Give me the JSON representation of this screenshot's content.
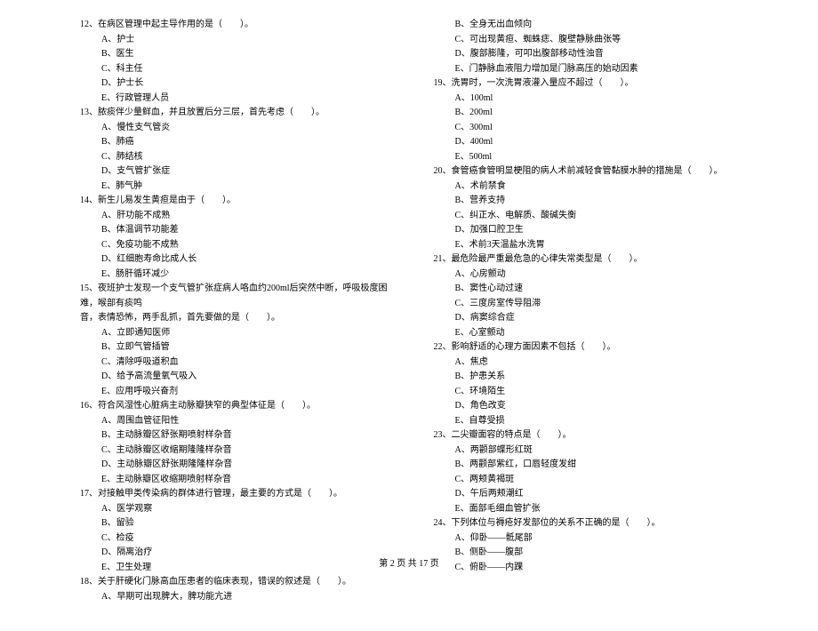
{
  "left_column": {
    "q12": {
      "stem": "12、在病区管理中起主导作用的是（　　）。",
      "options": [
        "A、护士",
        "B、医生",
        "C、科主任",
        "D、护士长",
        "E、行政管理人员"
      ]
    },
    "q13": {
      "stem": "13、脓痰伴少量鲜血，并且放置后分三层，首先考虑（　　）。",
      "options": [
        "A、慢性支气管炎",
        "B、肺癌",
        "C、肺结核",
        "D、支气管扩张症",
        "E、肺气肿"
      ]
    },
    "q14": {
      "stem": "14、新生儿易发生黄疸是由于（　　）。",
      "options": [
        "A、肝功能不成熟",
        "B、体温调节功能差",
        "C、免疫功能不成熟",
        "D、红细胞寿命比成人长",
        "E、肠肝循环减少"
      ]
    },
    "q15": {
      "stem": "15、夜班护士发现一个支气管扩张症病人咯血约200ml后突然中断，呼吸极度困难，喉部有痰鸣",
      "stem2": "音，表情恐怖，两手乱抓，首先要做的是（　　）。",
      "options": [
        "A、立即通知医师",
        "B、立即气管插管",
        "C、清除呼吸道积血",
        "D、给予高流量氧气吸入",
        "E、应用呼吸兴奋剂"
      ]
    },
    "q16": {
      "stem": "16、符合风湿性心脏病主动脉瓣狭窄的典型体征是（　　）。",
      "options": [
        "A、周围血管征阳性",
        "B、主动脉瓣区舒张期喷射样杂音",
        "C、主动脉瓣区收缩期隆隆样杂音",
        "D、主动脉瓣区舒张期隆隆样杂音",
        "E、主动脉瓣区收缩期喷射样杂音"
      ]
    },
    "q17": {
      "stem": "17、对接触甲类传染病的群体进行管理，最主要的方式是（　　）。",
      "options": [
        "A、医学观察",
        "B、留验",
        "C、检疫",
        "D、隔离治疗",
        "E、卫生处理"
      ]
    },
    "q18": {
      "stem": "18、关于肝硬化门脉高血压患者的临床表现，错误的叙述是（　　）。",
      "options": [
        "A、早期可出现脾大，脾功能亢进"
      ]
    }
  },
  "right_column": {
    "q18_cont": {
      "options": [
        "B、全身无出血倾向",
        "C、可出现黄疸、蜘蛛痣、腹壁静脉曲张等",
        "D、腹部膨隆，可叩出腹部移动性浊音",
        "E、门静脉血液阻力增加是门脉高压的始动因素"
      ]
    },
    "q19": {
      "stem": "19、洗胃时，一次洗胃液灌入量应不超过（　　）。",
      "options": [
        "A、100ml",
        "B、200ml",
        "C、300ml",
        "D、400ml",
        "E、500ml"
      ]
    },
    "q20": {
      "stem": "20、食管癌食管明显梗阻的病人术前减轻食管黏膜水肿的措施是（　　）。",
      "options": [
        "A、术前禁食",
        "B、营养支持",
        "C、纠正水、电解质、酸碱失衡",
        "D、加强口腔卫生",
        "E、术前3天温盐水洗胃"
      ]
    },
    "q21": {
      "stem": "21、最危险最严重最危急的心律失常类型是（　　）。",
      "options": [
        "A、心房颤动",
        "B、窦性心动过速",
        "C、三度房室传导阻滞",
        "D、病窦综合症",
        "E、心室颤动"
      ]
    },
    "q22": {
      "stem": "22、影响舒适的心理方面因素不包括（　　）。",
      "options": [
        "A、焦虑",
        "B、护患关系",
        "C、环境陌生",
        "D、角色改变",
        "E、自尊受损"
      ]
    },
    "q23": {
      "stem": "23、二尖瓣面容的特点是（　　）。",
      "options": [
        "A、两颧部蝶形红斑",
        "B、两颧部紫红，口唇轻度发绀",
        "C、两颊黄褐斑",
        "D、午后两颊潮红",
        "E、面部毛细血管扩张"
      ]
    },
    "q24": {
      "stem": "24、下列体位与褥疮好发部位的关系不正确的是（　　）。",
      "options": [
        "A、仰卧——骶尾部",
        "B、侧卧——腹部",
        "C、俯卧——内踝"
      ]
    }
  },
  "footer": "第 2 页 共 17 页"
}
